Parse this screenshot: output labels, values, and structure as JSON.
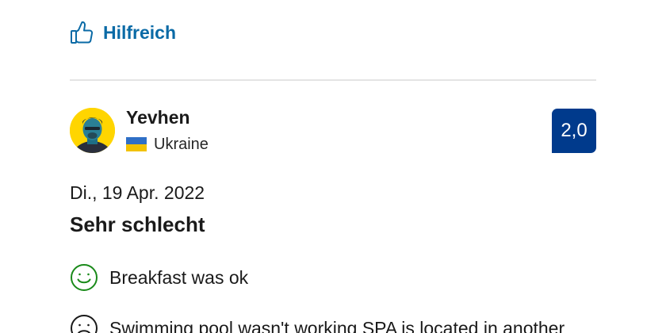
{
  "helpful": {
    "label": "Hilfreich",
    "icon": "thumbs-up-icon",
    "color": "#0a6aa6"
  },
  "reviewer": {
    "name": "Yevhen",
    "country": "Ukraine",
    "flag_icon": "ukraine-flag-icon",
    "avatar": "avatar-photo"
  },
  "score": {
    "value": "2,0",
    "color": "#003a8c"
  },
  "review": {
    "date": "Di., 19 Apr. 2022",
    "title": "Sehr schlecht",
    "positive": {
      "icon": "smiley-happy-icon",
      "text": "Breakfast was ok",
      "color": "#1a8a1a"
    },
    "negative": {
      "icon": "smiley-sad-icon",
      "text": "Swimming pool wasn't working SPA is located in another",
      "color": "#1a1a1a"
    }
  }
}
